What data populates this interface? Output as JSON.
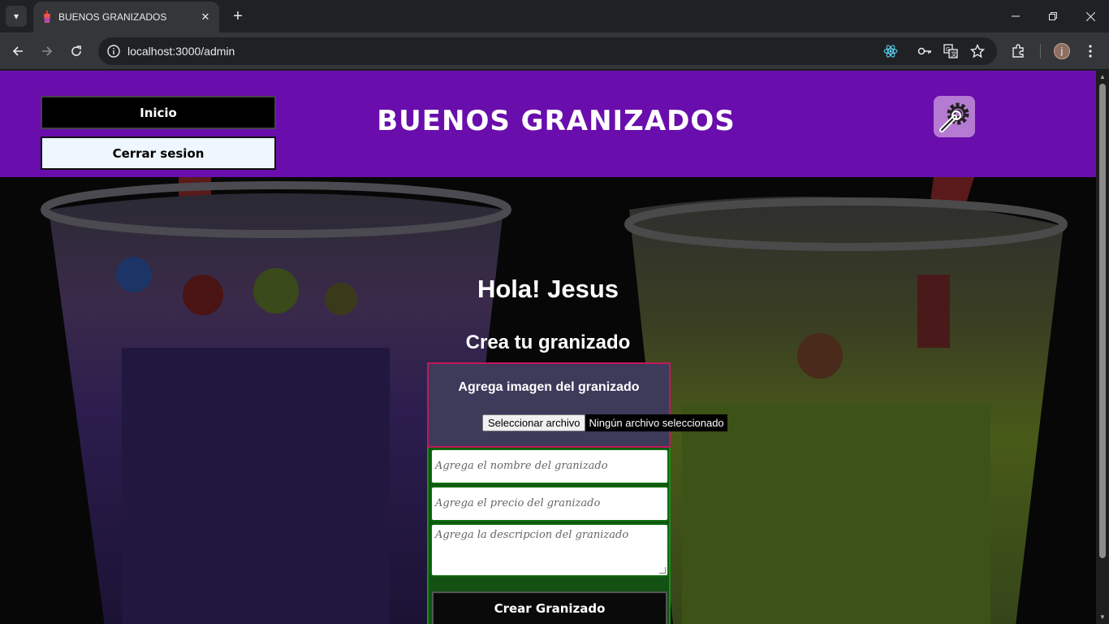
{
  "browser": {
    "tab_title": "BUENOS GRANIZADOS",
    "url": "localhost:3000/admin",
    "profile_initial": "j"
  },
  "header": {
    "inicio_label": "Inicio",
    "logout_label": "Cerrar sesion",
    "site_title": "BUENOS GRANIZADOS",
    "settings_icon": "settings-wrench-gear-icon"
  },
  "main": {
    "greeting": "Hola! Jesus",
    "subtitle": "Crea tu granizado"
  },
  "form": {
    "image_label": "Agrega imagen del granizado",
    "file_button": "Seleccionar archivo",
    "file_status": "Ningún archivo seleccionado",
    "name_placeholder": "Agrega el nombre del granizado",
    "price_placeholder": "Agrega el precio del granizado",
    "description_placeholder": "Agrega la descripcion del granizado",
    "submit_label": "Crear Granizado"
  },
  "colors": {
    "header_bg": "#6a0dad",
    "form_bg": "#145214",
    "image_section_bg": "#3d3a5a"
  }
}
